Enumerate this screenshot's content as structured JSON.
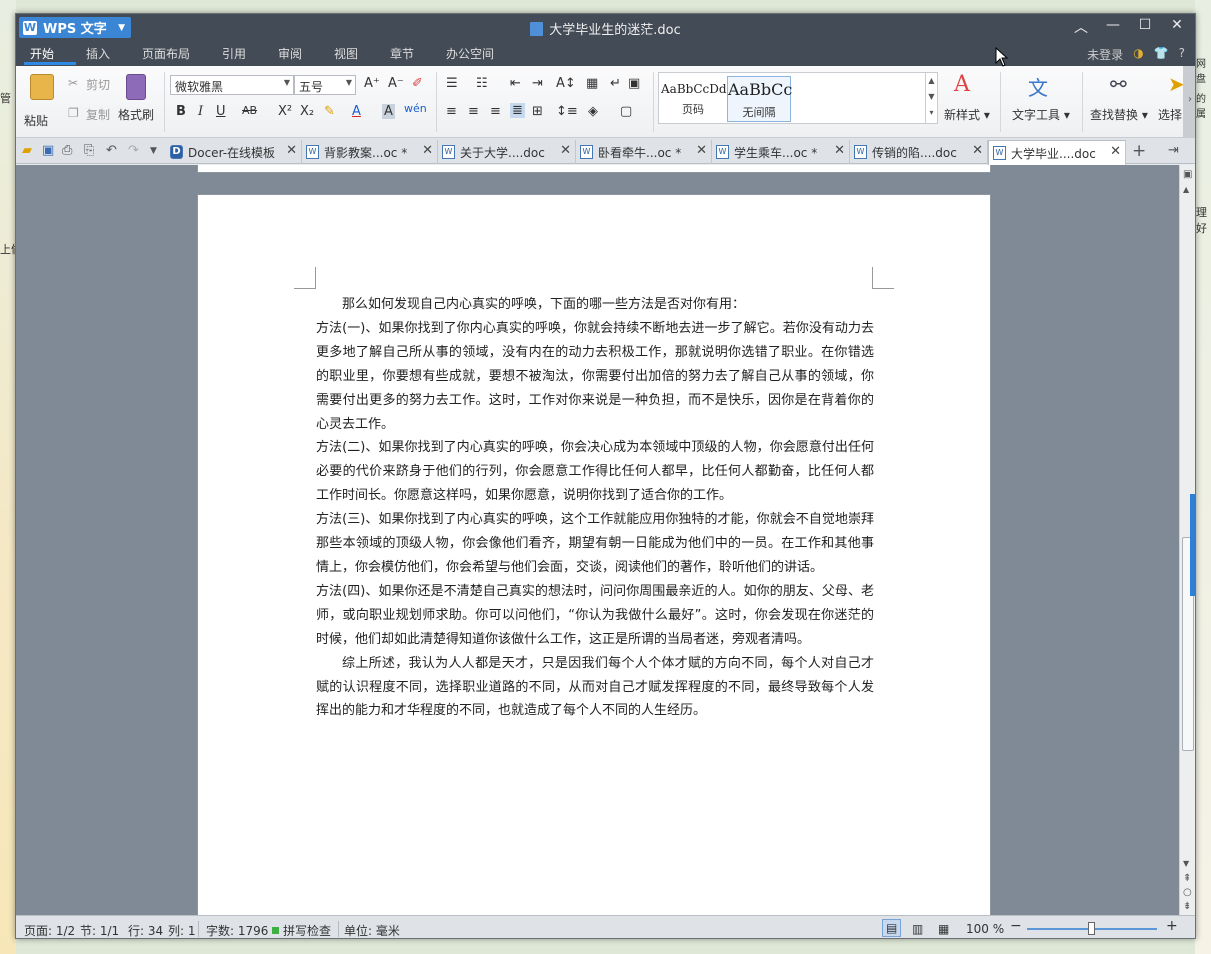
{
  "app": {
    "name": "WPS 文字",
    "document_title": "大学毕业生的迷茫.doc"
  },
  "menu": {
    "tabs": [
      "开始",
      "插入",
      "页面布局",
      "引用",
      "审阅",
      "视图",
      "章节",
      "办公空间"
    ],
    "login": "未登录",
    "help": "?"
  },
  "ribbon": {
    "paste": "粘贴",
    "cut": "剪切",
    "copy": "复制",
    "format_painter": "格式刷",
    "font_name": "微软雅黑",
    "font_size": "五号",
    "styles": [
      {
        "preview": "AaBbCcDd",
        "name": "页码"
      },
      {
        "preview": "AaBbCc",
        "name": "无间隔"
      }
    ],
    "new_style": "新样式",
    "text_tools": "文字工具",
    "find_replace": "查找替换",
    "select": "选择"
  },
  "doc_tabs": [
    {
      "label": "Docer-在线模板",
      "type": "docer"
    },
    {
      "label": "背影教案...oc *",
      "type": "doc"
    },
    {
      "label": "关于大学....doc",
      "type": "doc"
    },
    {
      "label": "卧看牵牛...oc *",
      "type": "doc"
    },
    {
      "label": "学生乘车...oc *",
      "type": "doc"
    },
    {
      "label": "传销的陷....doc",
      "type": "doc"
    },
    {
      "label": "大学毕业....doc",
      "type": "doc",
      "active": true
    }
  ],
  "document": {
    "paragraphs": [
      {
        "indent": true,
        "text": "那么如何发现自己内心真实的呼唤，下面的哪一些方法是否对你有用："
      },
      {
        "indent": false,
        "text": "方法(一)、如果你找到了你内心真实的呼唤，你就会持续不断地去进一步了解它。若你没有动力去更多地了解自己所从事的领域，没有内在的动力去积极工作，那就说明你选错了职业。在你错选的职业里，你要想有些成就，要想不被淘汰，你需要付出加倍的努力去了解自己从事的领域，你需要付出更多的努力去工作。这时，工作对你来说是一种负担，而不是快乐，因你是在背着你的心灵去工作。"
      },
      {
        "indent": false,
        "text": "方法(二)、如果你找到了内心真实的呼唤，你会决心成为本领域中顶级的人物，你会愿意付出任何必要的代价来跻身于他们的行列，你会愿意工作得比任何人都早，比任何人都勤奋，比任何人都工作时间长。你愿意这样吗，如果你愿意，说明你找到了适合你的工作。"
      },
      {
        "indent": false,
        "text": "方法(三)、如果你找到了内心真实的呼唤，这个工作就能应用你独特的才能，你就会不自觉地崇拜那些本领域的顶级人物，你会像他们看齐，期望有朝一日能成为他们中的一员。在工作和其他事情上，你会模仿他们，你会希望与他们会面，交谈，阅读他们的著作，聆听他们的讲话。"
      },
      {
        "indent": false,
        "text": "方法(四)、如果你还是不清楚自己真实的想法时，问问你周围最亲近的人。如你的朋友、父母、老师，或向职业规划师求助。你可以问他们，“你认为我做什么最好”。这时，你会发现在你迷茫的时候，他们却如此清楚得知道你该做什么工作，这正是所谓的当局者迷，旁观者清吗。"
      },
      {
        "indent": true,
        "text": "综上所述，我认为人人都是天才，只是因我们每个人个体才赋的方向不同，每个人对自己才赋的认识程度不同，选择职业道路的不同，从而对自己才赋发挥程度的不同，最终导致每个人发挥出的能力和才华程度的不同，也就造成了每个人不同的人生经历。"
      }
    ]
  },
  "status": {
    "page": "页面: 1/2",
    "section": "节: 1/1",
    "row": "行: 34",
    "col": "列: 1",
    "word_count": "字数: 1796",
    "spell_check": "拼写检查",
    "unit": "单位: 毫米",
    "zoom": "100 %",
    "zoom_fraction": 0.5
  },
  "desktop": {
    "frag_left_1": "管",
    "frag_left_2": "上偷",
    "frag_right_1": "网盘",
    "frag_right_2": "理好",
    "frag_right_3": "的属"
  },
  "colors": {
    "titlebar": "#434b56",
    "accent": "#2f8ae5",
    "wps_button": "#3a86d4"
  }
}
